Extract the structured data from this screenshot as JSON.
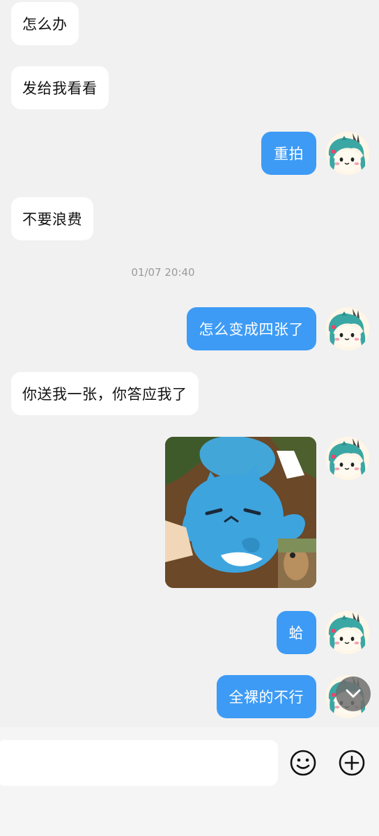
{
  "conversation": {
    "messages": [
      {
        "side": "in",
        "text": "怎么办"
      },
      {
        "side": "in",
        "text": "发给我看看"
      },
      {
        "side": "out",
        "text": "重拍"
      },
      {
        "side": "in",
        "text": "不要浪费"
      },
      {
        "side": "out",
        "text": "怎么变成四张了"
      },
      {
        "side": "in",
        "text": "你送我一张，你答应我了"
      },
      {
        "side": "out",
        "text": "蛤"
      },
      {
        "side": "out",
        "text": "全裸的不行"
      }
    ],
    "timestamp": "01/07 20:40"
  },
  "composer": {
    "input_value": "",
    "emoji_icon": "smiley-icon",
    "plus_icon": "plus-circle-icon"
  },
  "icons": {
    "scroll_down": "chevron-down-icon"
  },
  "colors": {
    "background": "#f1f1f1",
    "incoming_bubble": "#ffffff",
    "outgoing_bubble": "#3d9bf5",
    "timestamp_text": "#9a9a9a"
  }
}
